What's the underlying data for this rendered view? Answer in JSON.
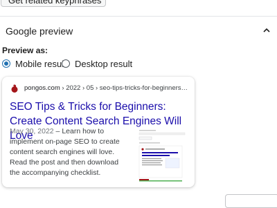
{
  "top_button": {
    "label": "Get related keyphrases"
  },
  "section": {
    "title": "Google preview"
  },
  "preview": {
    "label": "Preview as:",
    "options": [
      {
        "label": "Mobile result",
        "checked": true
      },
      {
        "label": "Desktop result",
        "checked": false
      }
    ]
  },
  "result": {
    "site": "pongos.com",
    "path": " › 2022 › 05 › seo-tips-tricks-for-beginners…",
    "title": "SEO Tips & Tricks for Beginners: Create Content Search Engines Will Love",
    "date": "May 30, 2022",
    "separator": " – ",
    "description": "Learn how to implement on-page SEO to create content search engines will love. Read the post and then download the accompanying checklist.",
    "favicon_color": "#a4161a",
    "title_color": "#1a0dab"
  },
  "colors": {
    "accent": "#2271b1",
    "brand_green": "#4caf50"
  }
}
